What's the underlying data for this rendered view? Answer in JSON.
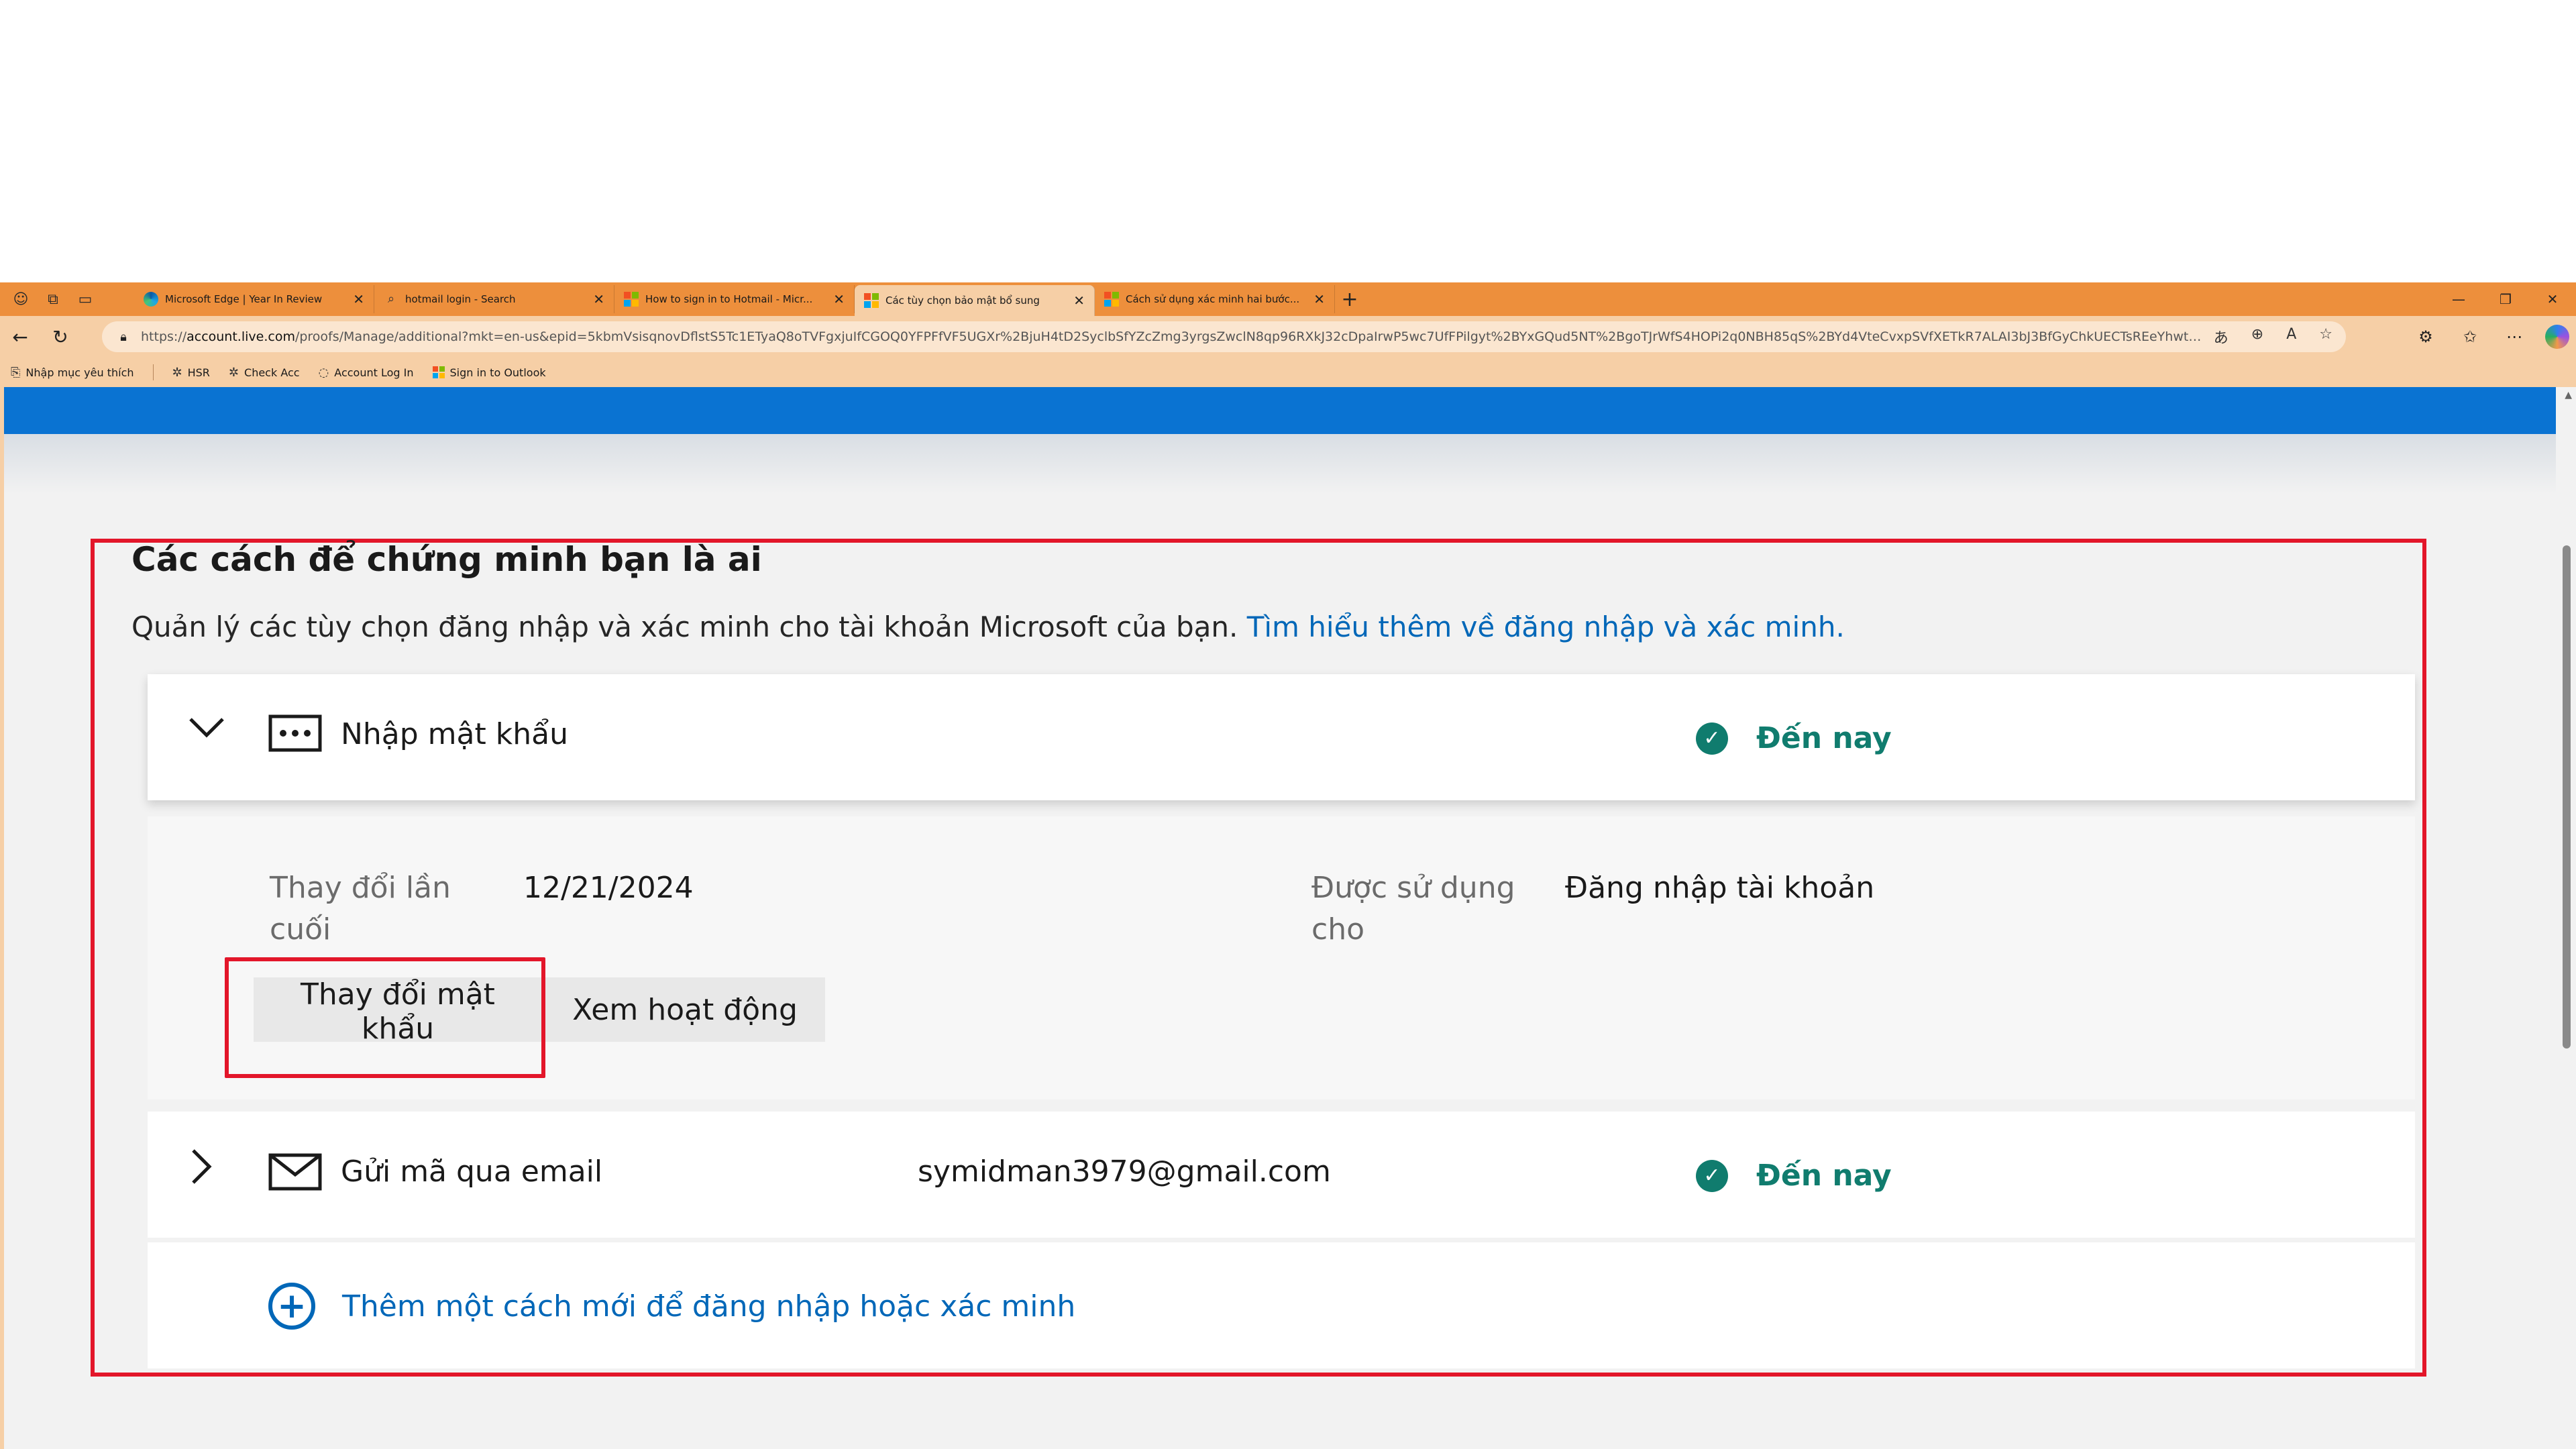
{
  "browser": {
    "tabs": [
      {
        "title": "Microsoft Edge | Year In Review",
        "icon": "edge-icon"
      },
      {
        "title": "hotmail login - Search",
        "icon": "search-icon"
      },
      {
        "title": "How to sign in to Hotmail - Micr...",
        "icon": "microsoft-icon"
      },
      {
        "title": "Các tùy chọn bảo mật bổ sung",
        "icon": "microsoft-icon",
        "active": true
      },
      {
        "title": "Cách sử dụng xác minh hai bước...",
        "icon": "microsoft-icon"
      }
    ],
    "address": {
      "scheme": "https://",
      "host": "account.live.com",
      "path": "/proofs/Manage/additional?mkt=en-us&epid=5kbmVsisqnovDflstS5Tc1ETyaQ8oTVFgxjuIfCGOQ0YFPFfVF5UGXr%2BjuH4tD2SyclbSfYZcZmg3yrgsZwclN8qp96RXkJ32cDpaIrwP5wc7UfFPilgyt%2BYxGQud5NT%2BgoTJrWfS4HOPi2q0NBH85qS%2BYd4VteCvxpSVfXETkR7ALAI3bJ3BfGyChkUECTsREeYhwt4Sc05hrl..."
    },
    "bookmarks": [
      {
        "label": "Nhập mục yêu thích",
        "icon": "import-favorites-icon"
      },
      {
        "label": "HSR",
        "icon": "puzzle-icon"
      },
      {
        "label": "Check Acc",
        "icon": "puzzle-icon"
      },
      {
        "label": "Account Log In",
        "icon": "loading-icon"
      },
      {
        "label": "Sign in to Outlook",
        "icon": "microsoft-icon"
      }
    ]
  },
  "section": {
    "title": "Các cách để chứng minh bạn là ai",
    "description": "Quản lý các tùy chọn đăng nhập và xác minh cho tài khoản Microsoft của bạn.",
    "learn_more": "Tìm hiểu thêm về đăng nhập và xác minh."
  },
  "password_row": {
    "label": "Nhập mật khẩu",
    "status": "Đến nay",
    "last_changed_label": "Thay đổi lần cuối",
    "last_changed_value": "12/21/2024",
    "used_for_label": "Được sử dụng cho",
    "used_for_value": "Đăng nhập tài khoản",
    "change_password_button": "Thay đổi mật khẩu",
    "view_activity_button": "Xem hoạt động"
  },
  "email_row": {
    "label": "Gửi mã qua email",
    "value": "symidman3979@gmail.com",
    "status": "Đến nay"
  },
  "add_method": {
    "label": "Thêm một cách mới để đăng nhập hoặc xác minh"
  },
  "colors": {
    "browser_accent": "#ed8f3c",
    "hero_blue": "#0a73d2",
    "link_blue": "#0067b8",
    "status_green": "#107c6e",
    "highlight_red": "#e3162a"
  }
}
